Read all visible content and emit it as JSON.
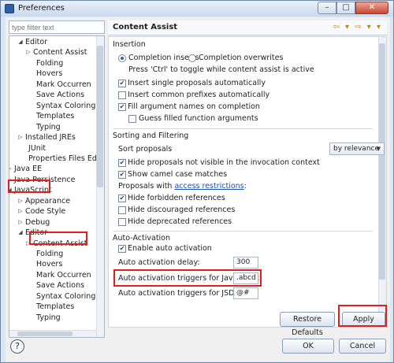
{
  "window": {
    "title": "Preferences",
    "minimize_glyph": "–",
    "maximize_glyph": "□",
    "close_glyph": "✕"
  },
  "filter": {
    "placeholder": "type filter text"
  },
  "tree": {
    "rows": [
      {
        "label": "Editor",
        "twisty": "◢"
      },
      {
        "label": "Content Assist",
        "twisty": "▷"
      },
      {
        "label": "Folding",
        "twisty": ""
      },
      {
        "label": "Hovers",
        "twisty": ""
      },
      {
        "label": "Mark Occurren",
        "twisty": ""
      },
      {
        "label": "Save Actions",
        "twisty": ""
      },
      {
        "label": "Syntax Coloring",
        "twisty": ""
      },
      {
        "label": "Templates",
        "twisty": ""
      },
      {
        "label": "Typing",
        "twisty": ""
      },
      {
        "label": "Installed JREs",
        "twisty": "▷"
      },
      {
        "label": "JUnit",
        "twisty": ""
      },
      {
        "label": "Properties Files Ed",
        "twisty": ""
      },
      {
        "label": "Java EE",
        "twisty": "▷"
      },
      {
        "label": "Java Persistence",
        "twisty": "▷"
      },
      {
        "label": "JavaScript",
        "twisty": "◢"
      },
      {
        "label": "Appearance",
        "twisty": "▷"
      },
      {
        "label": "Code Style",
        "twisty": "▷"
      },
      {
        "label": "Debug",
        "twisty": "▷"
      },
      {
        "label": "Editor",
        "twisty": "◢"
      },
      {
        "label": "Content Assist",
        "twisty": "▷"
      },
      {
        "label": "Folding",
        "twisty": ""
      },
      {
        "label": "Hovers",
        "twisty": ""
      },
      {
        "label": "Mark Occurren",
        "twisty": ""
      },
      {
        "label": "Save Actions",
        "twisty": ""
      },
      {
        "label": "Syntax Coloring",
        "twisty": ""
      },
      {
        "label": "Templates",
        "twisty": ""
      },
      {
        "label": "Typing",
        "twisty": ""
      }
    ]
  },
  "panel": {
    "title": "Content Assist",
    "nav": "⇦ ▾ ⇨ ▾ ▾",
    "insertion": {
      "title": "Insertion",
      "radio_inserts": "Completion inserts",
      "radio_overwrites": "Completion overwrites",
      "hint": "Press 'Ctrl' to toggle while content assist is active",
      "checks": [
        {
          "label": "Insert single proposals automatically",
          "checked": true
        },
        {
          "label": "Insert common prefixes automatically",
          "checked": false
        },
        {
          "label": "Fill argument names on completion",
          "checked": true
        },
        {
          "label": "Guess filled function arguments",
          "checked": false
        }
      ]
    },
    "sorting": {
      "title": "Sorting and Filtering",
      "sort_label": "Sort proposals",
      "sort_value": "by relevance",
      "checks_a": [
        {
          "label": "Hide proposals not visible in the invocation context",
          "checked": true
        },
        {
          "label": "Show camel case matches",
          "checked": true
        }
      ],
      "proposals_with": "Proposals with ",
      "access_link": "access restrictions",
      "colon": ":",
      "checks_b": [
        {
          "label": "Hide forbidden references",
          "checked": true
        },
        {
          "label": "Hide discouraged references",
          "checked": false
        },
        {
          "label": "Hide deprecated references",
          "checked": false
        }
      ]
    },
    "auto": {
      "title": "Auto-Activation",
      "enable_label": "Enable auto activation",
      "enable_checked": true,
      "delay_label": "Auto activation delay:",
      "delay_value": "300",
      "triggers_js_label": "Auto activation triggers for JavaScript:",
      "triggers_js_value": ".abcd",
      "triggers_jsdoc_label": "Auto activation triggers for JSDoc:",
      "triggers_jsdoc_value": "@#"
    }
  },
  "buttons": {
    "restore": "Restore Defaults",
    "apply": "Apply",
    "ok": "OK",
    "cancel": "Cancel",
    "help": "?"
  },
  "colors": {
    "highlight": "#e02020",
    "link": "#1a4fb3"
  }
}
